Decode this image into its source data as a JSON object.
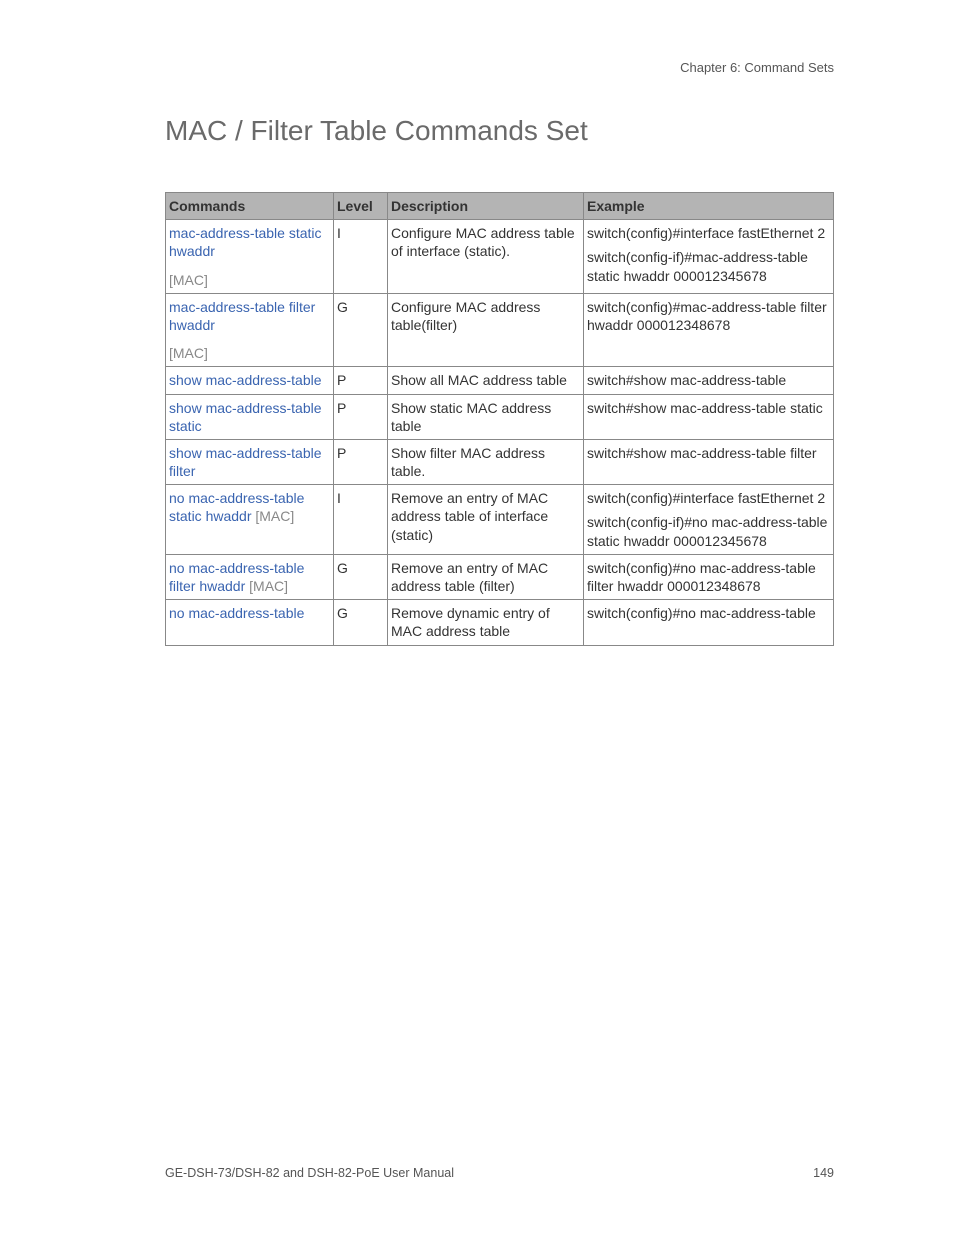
{
  "chapter_label": "Chapter 6: Command Sets",
  "title": "MAC / Filter Table Commands Set",
  "headers": {
    "commands": "Commands",
    "level": "Level",
    "description": "Description",
    "example": "Example"
  },
  "rows": [
    {
      "command_link": "mac-address-table static hwaddr",
      "command_param": "[MAC]",
      "level": "I",
      "description": "Configure MAC address table of interface (static).",
      "example": [
        "switch(config)#interface fastEthernet 2",
        "switch(config-if)#mac-address-table static hwaddr 000012345678"
      ]
    },
    {
      "command_link": "mac-address-table filter hwaddr",
      "command_param": "[MAC]",
      "level": "G",
      "description": "Configure MAC address table(filter)",
      "example": [
        "switch(config)#mac-address-table filter hwaddr 000012348678"
      ]
    },
    {
      "command_link": "show mac-address-table",
      "command_param": "",
      "level": "P",
      "description": "Show all MAC address table",
      "example": [
        "switch#show mac-address-table"
      ]
    },
    {
      "command_link": "show mac-address-table static",
      "command_param": "",
      "level": "P",
      "description": "Show static MAC address table",
      "example": [
        "switch#show mac-address-table static"
      ]
    },
    {
      "command_link": "show mac-address-table filter",
      "command_param": "",
      "level": "P",
      "description": "Show filter MAC address table.",
      "example": [
        "switch#show mac-address-table filter"
      ]
    },
    {
      "command_link": "no mac-address-table static hwaddr",
      "command_param": " [MAC]",
      "level": "I",
      "description": "Remove an entry of MAC address table of interface (static)",
      "example": [
        "switch(config)#interface fastEthernet 2",
        "switch(config-if)#no mac-address-table static hwaddr 000012345678"
      ]
    },
    {
      "command_link": "no mac-address-table filter hwaddr",
      "command_param": " [MAC]",
      "level": "G",
      "description": "Remove an entry of MAC address table (filter)",
      "example": [
        "switch(config)#no mac-address-table filter hwaddr 000012348678"
      ]
    },
    {
      "command_link": "no mac-address-table",
      "command_param": "",
      "level": "G",
      "description": "Remove dynamic entry of MAC address table",
      "example": [
        "switch(config)#no mac-address-table"
      ]
    }
  ],
  "footer": {
    "left": "GE-DSH-73/DSH-82 and DSH-82-PoE User Manual",
    "right": "149"
  }
}
